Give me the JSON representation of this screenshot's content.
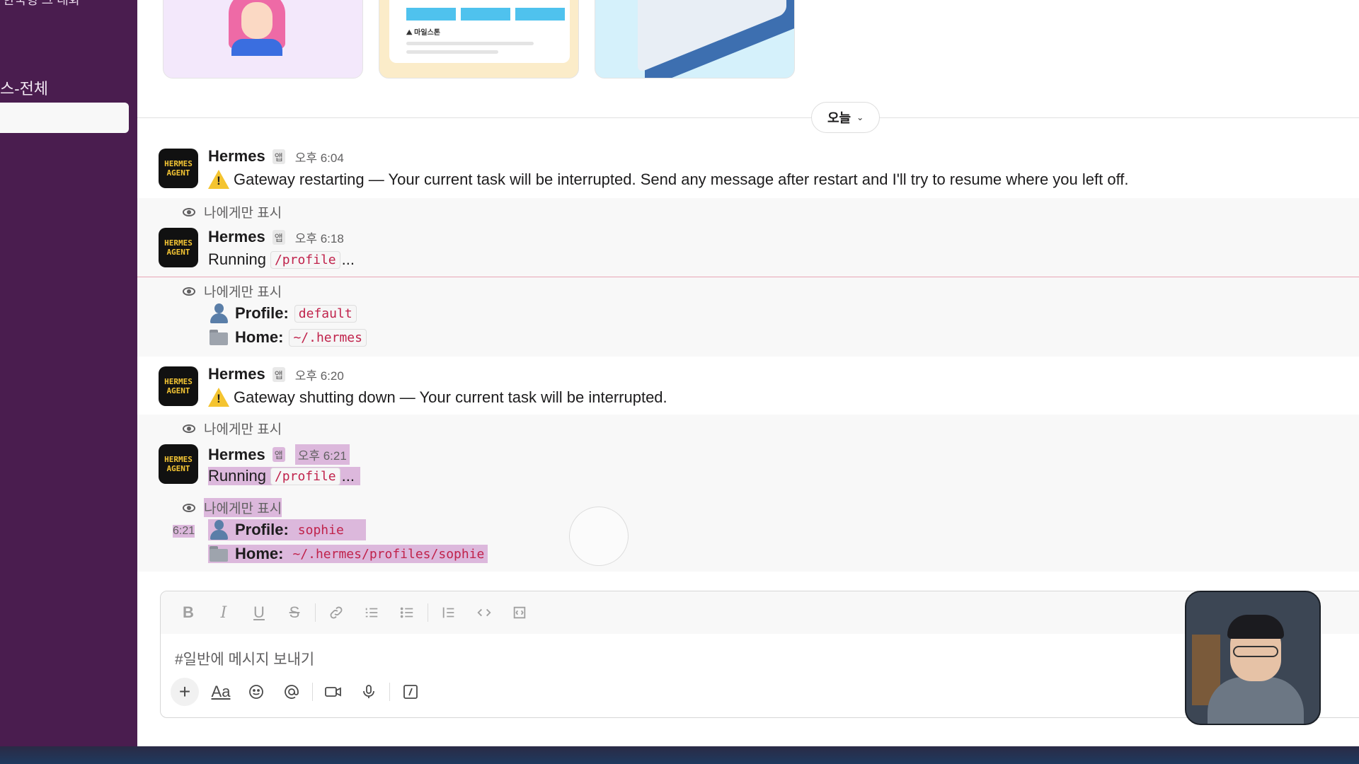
{
  "sidebar": {
    "cut_title": "한국형 그 대화",
    "channel_label": "스-전체"
  },
  "cards": {
    "milestone_label": "⛰ 마일스톤"
  },
  "date_divider": {
    "label": "오늘"
  },
  "messages": [
    {
      "avatar_text": [
        "HERMES",
        "AGENT"
      ],
      "name": "Hermes",
      "badge": "앱",
      "time": "오후 6:04",
      "text": "Gateway restarting — Your current task will be interrupted. Send any message after restart and I'll try to resume where you left off."
    },
    {
      "only_visible": "나에게만 표시",
      "avatar_text": [
        "HERMES",
        "AGENT"
      ],
      "name": "Hermes",
      "badge": "앱",
      "time": "오후 6:18",
      "text_prefix": "Running",
      "code": "/profile",
      "text_suffix": "..."
    },
    {
      "only_visible": "나에게만 표시",
      "profile_key": "Profile:",
      "profile_value": "default",
      "home_key": "Home:",
      "home_value": "~/.hermes"
    },
    {
      "avatar_text": [
        "HERMES",
        "AGENT"
      ],
      "name": "Hermes",
      "badge": "앱",
      "time": "오후 6:20",
      "text": "Gateway shutting down — Your current task will be interrupted."
    },
    {
      "only_visible": "나에게만 표시",
      "avatar_text": [
        "HERMES",
        "AGENT"
      ],
      "name": "Hermes",
      "badge": "앱",
      "time": "오후 6:21",
      "text_prefix": "Running",
      "code": "/profile",
      "text_suffix": "..."
    },
    {
      "only_visible": "나에게만 표시",
      "side_time": "6:21",
      "profile_key": "Profile:",
      "profile_value": "sophie",
      "home_key": "Home:",
      "home_value": "~/.hermes/profiles/sophie"
    }
  ],
  "composer": {
    "placeholder": "#일반에 메시지 보내기",
    "format_icons": [
      "bold-icon",
      "italic-icon",
      "underline-icon",
      "strikethrough-icon",
      "link-icon",
      "ordered-list-icon",
      "bullet-list-icon",
      "blockquote-icon",
      "code-icon",
      "code-block-icon"
    ],
    "aa_label": "Aa"
  },
  "colors": {
    "sidebar": "#4a1d4f",
    "code_text": "#c0224b",
    "highlight": "#dcb8dc",
    "warning": "#f4c430",
    "avatar_text": "#f4c534"
  }
}
